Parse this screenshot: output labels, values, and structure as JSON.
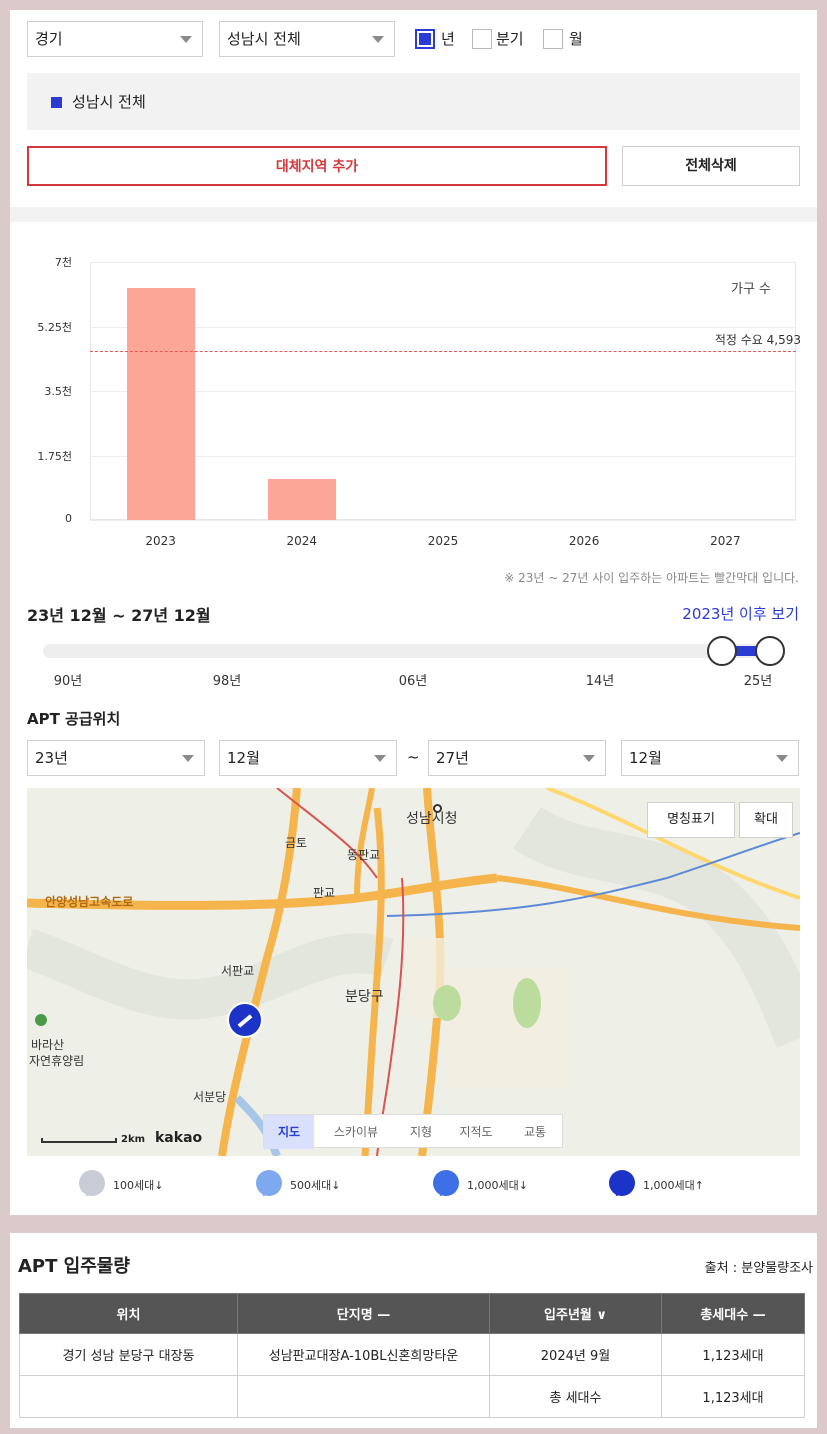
{
  "filters": {
    "region": "경기",
    "subregion": "성남시 전체",
    "period_options": [
      {
        "label": "년",
        "checked": true
      },
      {
        "label": "분기",
        "checked": false
      },
      {
        "label": "월",
        "checked": false
      }
    ]
  },
  "selected_area": {
    "label": "성남시 전체",
    "color": "#2a3bd6"
  },
  "buttons": {
    "add_area": "대체지역 추가",
    "delete_all": "전체삭제"
  },
  "chart_data": {
    "type": "bar",
    "categories": [
      "2023",
      "2024",
      "2025",
      "2026",
      "2027"
    ],
    "values": [
      6300,
      1123,
      0,
      0,
      0
    ],
    "ylim": [
      0,
      7000
    ],
    "yticks": [
      "7천",
      "5.25천",
      "3.5천",
      "1.75천",
      "0"
    ],
    "ylabel": "가구 수",
    "bar_color": "#fca698",
    "reference_line": {
      "label": "적정 수요 4,593",
      "value": 4593,
      "color": "#e25a5a"
    },
    "grid": true
  },
  "chart_note": "※ 23년 ~ 27년 사이 입주하는 아파트는 빨간막대 입니다.",
  "range": {
    "title": "23년 12월 ~ 27년 12월",
    "link": "2023년 이후 보기"
  },
  "slider": {
    "labels": [
      "90년",
      "98년",
      "06년",
      "14년",
      "25년"
    ],
    "accent": "#2a3bd6"
  },
  "supply": {
    "title": "APT 공급위치",
    "from_year": "23년",
    "from_month": "12월",
    "separator": "~",
    "to_year": "27년",
    "to_month": "12월"
  },
  "map": {
    "btn_names": "명칭표기",
    "btn_zoom": "확대",
    "labels": [
      "성남시청",
      "동판교",
      "판교",
      "금토",
      "안양성남고속도로",
      "서판교",
      "분당구",
      "바라산",
      "자연휴양림",
      "서분당"
    ],
    "scale": "2km",
    "brand": "kakao",
    "tabs": [
      "지도",
      "스카이뷰",
      "지형",
      "지적도",
      "교통"
    ],
    "active_tab": 0
  },
  "map_legend": [
    {
      "label": "100세대↓",
      "color": "#c9ccd6"
    },
    {
      "label": "500세대↓",
      "color": "#7ea9ef"
    },
    {
      "label": "1,000세대↓",
      "color": "#3d6fe6"
    },
    {
      "label": "1,000세대↑",
      "color": "#1c33c8"
    }
  ],
  "move_in": {
    "title": "APT 입주물량",
    "source": "출처 : 분양물량조사",
    "headers": [
      "위치",
      "단지명 —",
      "입주년월 ∨",
      "총세대수 —"
    ],
    "rows": [
      [
        "경기 성남 분당구 대장동",
        "성남판교대장A-10BL신혼희망타운",
        "2024년 9월",
        "1,123세대"
      ]
    ],
    "total_label": "총 세대수",
    "total_value": "1,123세대"
  }
}
